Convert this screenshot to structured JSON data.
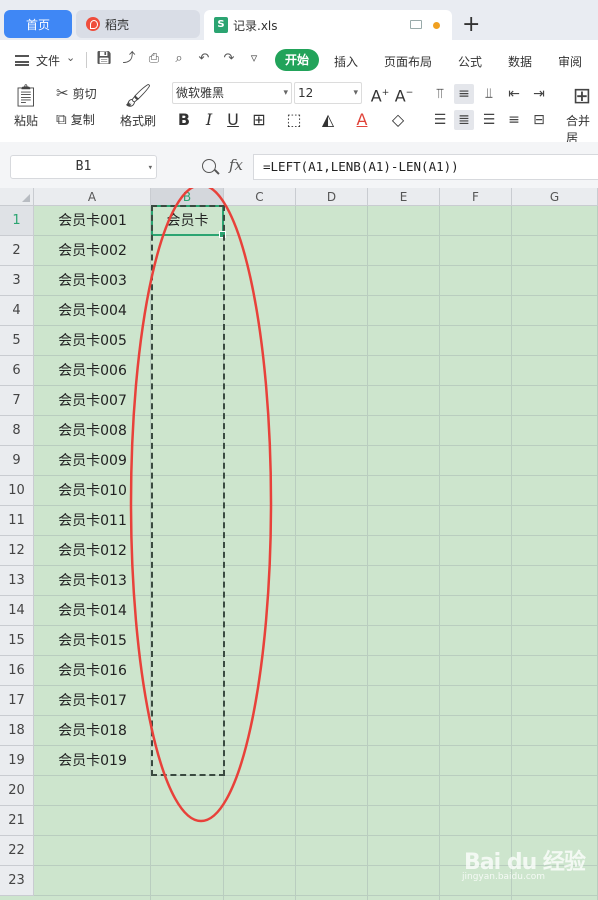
{
  "tabs": {
    "home": "首页",
    "shell": "稻壳",
    "file": "记录.xls",
    "new_tab": "+"
  },
  "menubar": {
    "file_menu": "文件",
    "items": [
      "开始",
      "插入",
      "页面布局",
      "公式",
      "数据",
      "审阅"
    ]
  },
  "ribbon": {
    "paste": "粘贴",
    "cut": "剪切",
    "copy": "复制",
    "format_painter": "格式刷",
    "font_name": "微软雅黑",
    "font_size": "12",
    "merge": "合并居"
  },
  "formula_bar": {
    "name_box": "B1",
    "fx": "fx",
    "formula": "=LEFT(A1,LENB(A1)-LEN(A1))"
  },
  "sheet": {
    "columns": [
      "A",
      "B",
      "C",
      "D",
      "E",
      "F",
      "G"
    ],
    "rows": [
      "1",
      "2",
      "3",
      "4",
      "5",
      "6",
      "7",
      "8",
      "9",
      "10",
      "11",
      "12",
      "13",
      "14",
      "15",
      "16",
      "17",
      "18",
      "19",
      "20",
      "21",
      "22",
      "23"
    ],
    "col_a": [
      "会员卡001",
      "会员卡002",
      "会员卡003",
      "会员卡004",
      "会员卡005",
      "会员卡006",
      "会员卡007",
      "会员卡008",
      "会员卡009",
      "会员卡010",
      "会员卡011",
      "会员卡012",
      "会员卡013",
      "会员卡014",
      "会员卡015",
      "会员卡016",
      "会员卡017",
      "会员卡018",
      "会员卡019"
    ],
    "b1": "会员卡",
    "selected_column": "B",
    "selected_row": "1"
  },
  "watermark": {
    "main": "Bai du 经验",
    "sub": "jingyan.baidu.com"
  },
  "colors": {
    "accent_green": "#2ba471",
    "sheet_bg": "#cde5cd",
    "annotation_red": "#e8413a",
    "home_tab": "#3f87f5"
  }
}
